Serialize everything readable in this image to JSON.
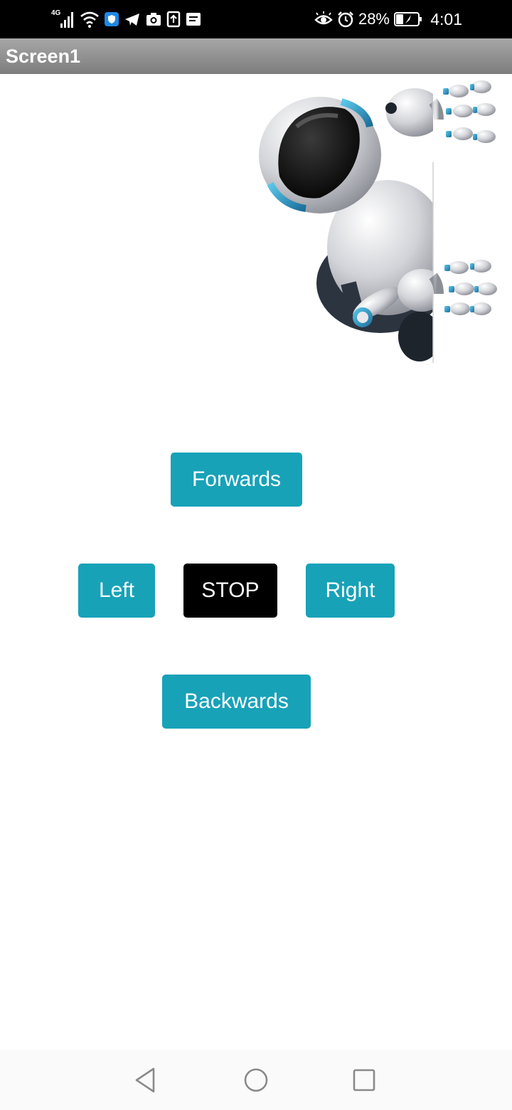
{
  "status_bar": {
    "network_label": "4G",
    "battery_percent": "28%",
    "time": "4:01",
    "icons": [
      "signal-icon",
      "wifi-icon",
      "shield-app-icon",
      "telegram-icon",
      "camera-icon",
      "upload-icon",
      "message-icon",
      "eye-icon",
      "alarm-icon",
      "battery-icon"
    ]
  },
  "app_bar": {
    "title": "Screen1"
  },
  "controls": {
    "forwards": "Forwards",
    "left": "Left",
    "stop": "STOP",
    "right": "Right",
    "backwards": "Backwards"
  },
  "colors": {
    "button": "#17a2b8",
    "stop_button": "#000000",
    "app_bar": "#8f8f8f"
  },
  "nav_bar": {
    "icons": [
      "back-triangle-icon",
      "home-circle-icon",
      "recents-square-icon"
    ]
  }
}
